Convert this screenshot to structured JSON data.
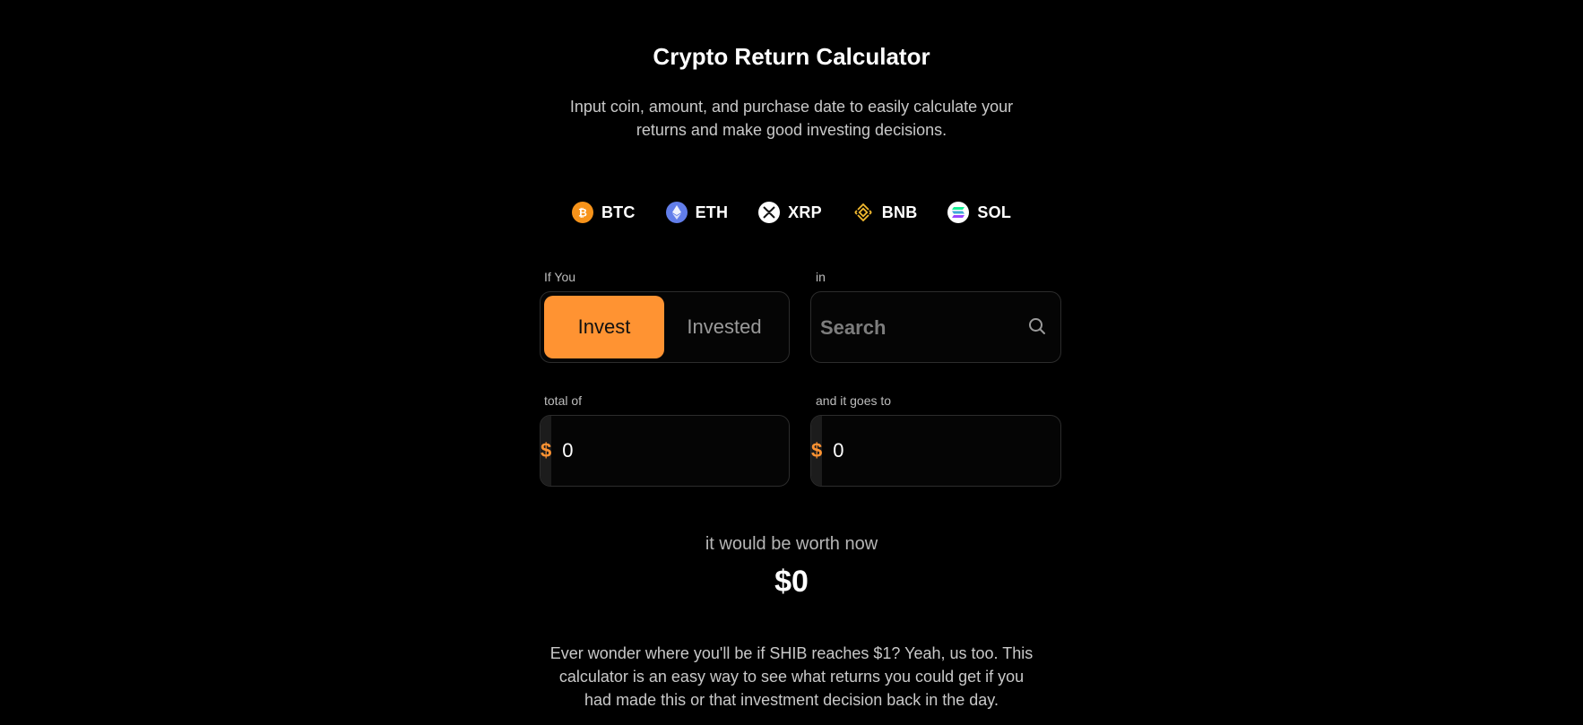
{
  "header": {
    "title": "Crypto Return Calculator",
    "subtitle": "Input coin, amount, and purchase date to easily calculate your returns and make good investing decisions."
  },
  "coins": [
    {
      "symbol": "BTC",
      "icon": "bitcoin-icon",
      "color": "#f7931a"
    },
    {
      "symbol": "ETH",
      "icon": "ethereum-icon",
      "color": "#627eea"
    },
    {
      "symbol": "XRP",
      "icon": "xrp-icon",
      "color": "#ffffff"
    },
    {
      "symbol": "BNB",
      "icon": "bnb-icon",
      "color": "#f3ba2f"
    },
    {
      "symbol": "SOL",
      "icon": "solana-icon",
      "color": "#ffffff"
    }
  ],
  "form": {
    "if_you_label": "If You",
    "toggle": {
      "active": "Invest",
      "inactive": "Invested"
    },
    "in_label": "in",
    "search": {
      "placeholder": "Search",
      "icon": "search-icon"
    },
    "total_label": "total of",
    "total": {
      "prefix": "$",
      "value": "0"
    },
    "goes_to_label": "and it goes to",
    "goes_to": {
      "prefix": "$",
      "value": "0"
    }
  },
  "result": {
    "label": "it would be worth now",
    "value": "$0"
  },
  "footer": {
    "text": "Ever wonder where you'll be if SHIB reaches $1? Yeah, us too. This calculator is an easy way to see what returns you could get if you had made this or that investment decision back in the day."
  },
  "colors": {
    "accent": "#ff9332",
    "background": "#000000",
    "border": "#2c2c2c"
  }
}
